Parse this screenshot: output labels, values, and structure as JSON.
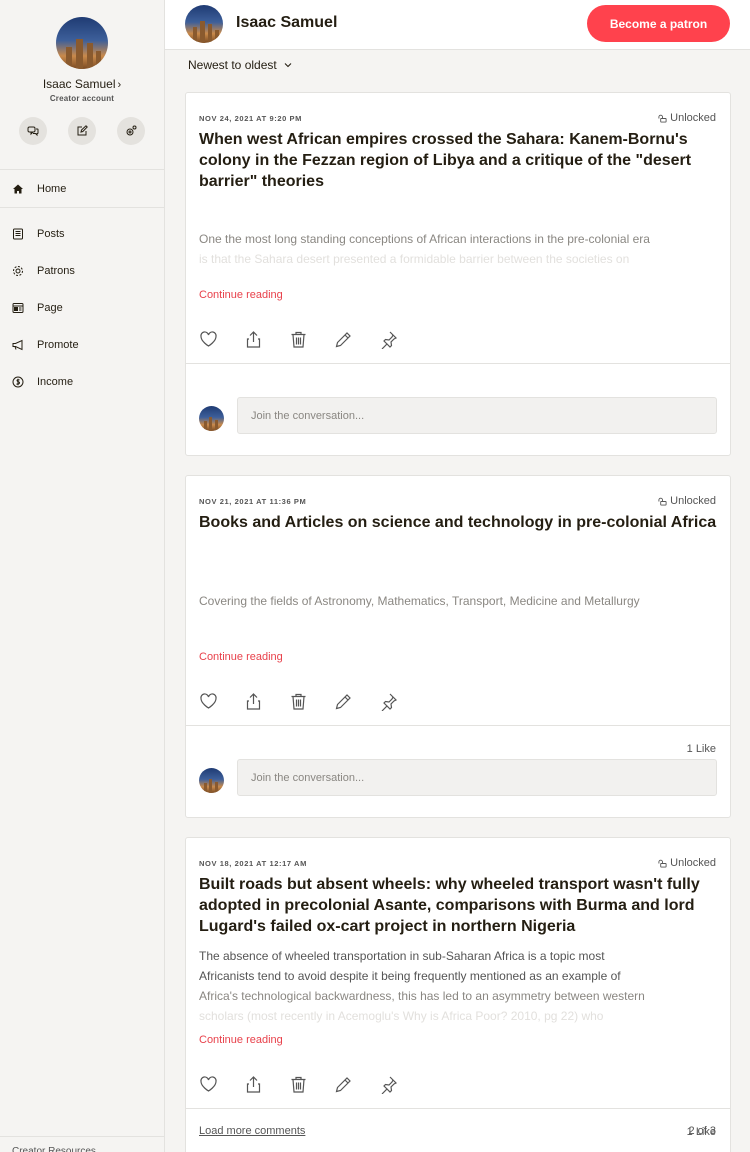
{
  "sidebar": {
    "profile_name": "Isaac Samuel",
    "profile_sub": "Creator account",
    "quick_actions": [
      "chat-icon",
      "edit-icon",
      "settings-icon"
    ],
    "nav": [
      {
        "label": "Home",
        "icon": "home-icon",
        "active": true
      },
      {
        "label": "Posts",
        "icon": "posts-icon"
      },
      {
        "label": "Patrons",
        "icon": "patrons-icon"
      },
      {
        "label": "Page",
        "icon": "page-icon"
      },
      {
        "label": "Promote",
        "icon": "megaphone-icon"
      },
      {
        "label": "Income",
        "icon": "dollar-icon"
      }
    ],
    "footer": "Creator Resources"
  },
  "header": {
    "title": "Isaac Samuel",
    "patron_button": "Become a patron"
  },
  "sort": {
    "label": "Newest to oldest"
  },
  "posts": [
    {
      "date": "NOV 24, 2021 AT 9:20 PM",
      "lock": "Unlocked",
      "title": "When west African empires crossed the Sahara: Kanem-Bornu's colony in the Fezzan region of Libya and a critique of the \"desert barrier\" theories",
      "excerpt_lines": [
        "One the most long standing conceptions of African interactions in the pre-colonial era",
        "is that the Sahara desert presented a formidable barrier between the societies on"
      ],
      "continue": "Continue reading",
      "likes": "",
      "comment_placeholder": "Join the conversation..."
    },
    {
      "date": "NOV 21, 2021 AT 11:36 PM",
      "lock": "Unlocked",
      "title": "Books and Articles on science and technology in pre-colonial Africa",
      "excerpt_lines": [
        "Covering the fields of Astronomy, Mathematics, Transport, Medicine and Metallurgy"
      ],
      "continue": "Continue reading",
      "likes": "1 Like",
      "comment_placeholder": "Join the conversation..."
    },
    {
      "date": "NOV 18, 2021 AT 12:17 AM",
      "lock": "Unlocked",
      "title": "Built roads but absent wheels: why wheeled transport wasn't fully adopted in precolonial Asante, comparisons with Burma and lord Lugard's failed ox-cart project in northern Nigeria",
      "excerpt_lines": [
        "The absence of wheeled transportation in sub-Saharan Africa is a topic most",
        "Africanists tend to avoid despite it being frequently mentioned as an example of",
        "Africa's technological backwardness, this has led to an asymmetry between western",
        "scholars (most recently in Acemoglu's Why is Africa Poor? 2010, pg 22) who"
      ],
      "continue": "Continue reading",
      "likes": "1 Like",
      "load_more": "Load more comments",
      "page_count": "2 of 3"
    }
  ]
}
